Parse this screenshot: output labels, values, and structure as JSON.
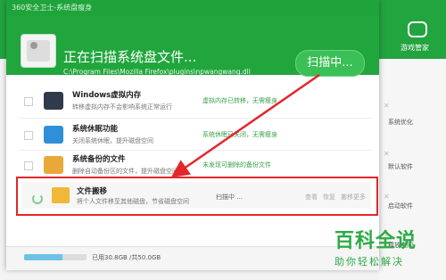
{
  "background_app": {
    "game_label": "游戏管家",
    "side_texts": [
      "系统优化",
      "默认软件",
      "启动软件",
      "释放空间"
    ]
  },
  "dialog": {
    "title": "360安全卫士-系统盘瘦身",
    "scan_title": "正在扫描系统盘文件...",
    "scan_path": "C:\\Program Files\\Mozilla Firefox\\plugins\\npwangwang.dll",
    "scan_button": "扫描中...",
    "items": [
      {
        "name": "Windows虚拟内存",
        "desc": "转移虚拟内存不会影响系统正常运行",
        "status": "虚拟内存已转移，无需瘦身"
      },
      {
        "name": "系统休眠功能",
        "desc": "关闭系统休眠，提升磁盘空间",
        "status": "系统休眠已关闭，无需瘦身"
      },
      {
        "name": "系统备份的文件",
        "desc": "删除自动备份区的文件，提升磁盘空间",
        "status": "未发现可删除的备份文件"
      }
    ],
    "active_item": {
      "name": "文件搬移",
      "desc": "将个人文件移至其他磁盘，节省磁盘空间",
      "status": "扫描中 ...",
      "links": [
        "查看",
        "恢复",
        "搬移更多"
      ]
    },
    "footer": {
      "used_text": "已用30.8GB /共50.0GB",
      "used_fraction": 0.616
    }
  },
  "watermark": {
    "main": "百科全说",
    "sub": "助你轻松解决"
  },
  "colors": {
    "brand_green": "#21a63d",
    "highlight_red": "#e3262a"
  }
}
